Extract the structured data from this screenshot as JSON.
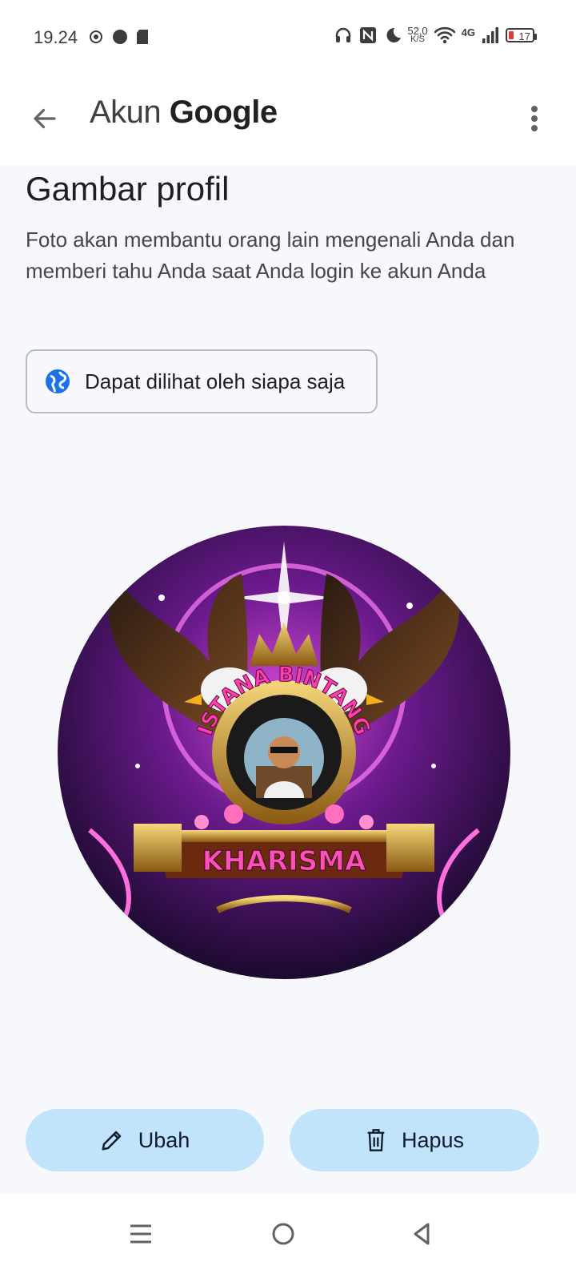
{
  "status_bar": {
    "time": "19.24",
    "net_speed_value": "52,0",
    "net_speed_unit": "K/S",
    "network": "4G",
    "battery": "17",
    "icons": [
      "notification-icon",
      "record-dot-icon",
      "sd-card-icon",
      "headphones-icon",
      "nfc-icon",
      "moon-icon",
      "wifi-icon",
      "signal-icon",
      "battery-icon"
    ]
  },
  "app_bar": {
    "title_prefix": "Akun",
    "title_brand": "Google",
    "back_icon": "arrow-back-icon",
    "menu_icon": "more-vert-icon"
  },
  "page": {
    "title": "Gambar profil",
    "description": "Foto akan membantu orang lain mengenali Anda dan memberi tahu Anda saat Anda login ke akun Anda",
    "visibility_label": "Dapat dilihat oleh siapa saja"
  },
  "profile_image": {
    "text_top": "ISTANA BINTANG",
    "text_bottom": "KHARISMA"
  },
  "actions": {
    "edit_label": "Ubah",
    "delete_label": "Hapus"
  },
  "colors": {
    "background": "#f6f8fc",
    "button_fill": "#c2e4fb",
    "globe": "#1a73e8",
    "battery_low": "#e53935"
  }
}
